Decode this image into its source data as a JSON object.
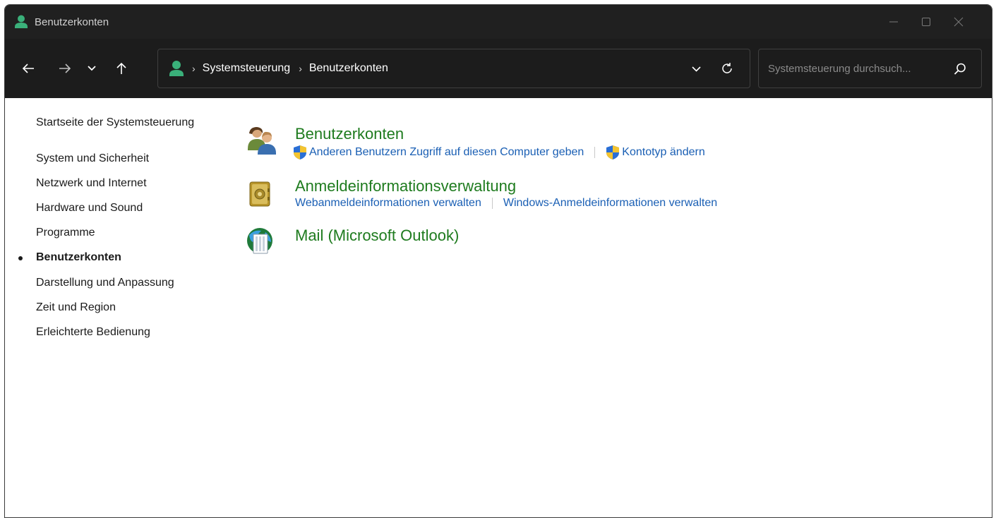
{
  "window": {
    "title": "Benutzerkonten"
  },
  "navbar": {
    "breadcrumb": [
      "Systemsteuerung",
      "Benutzerkonten"
    ],
    "search_placeholder": "Systemsteuerung durchsuch..."
  },
  "sidebar": {
    "home": "Startseite der Systemsteuerung",
    "items": [
      {
        "label": "System und Sicherheit"
      },
      {
        "label": "Netzwerk und Internet"
      },
      {
        "label": "Hardware und Sound"
      },
      {
        "label": "Programme"
      },
      {
        "label": "Benutzerkonten",
        "active": true
      },
      {
        "label": "Darstellung und Anpassung"
      },
      {
        "label": "Zeit und Region"
      },
      {
        "label": "Erleichterte Bedienung"
      }
    ]
  },
  "categories": [
    {
      "title": "Benutzerkonten",
      "icon": "users-icon",
      "links": [
        {
          "label": "Anderen Benutzern Zugriff auf diesen Computer geben",
          "shield": true
        },
        {
          "label": "Kontotyp ändern",
          "shield": true
        }
      ]
    },
    {
      "title": "Anmeldeinformationsverwaltung",
      "icon": "vault-icon",
      "links": [
        {
          "label": "Webanmeldeinformationen verwalten",
          "shield": false
        },
        {
          "label": "Windows-Anmeldeinformationen verwalten",
          "shield": false
        }
      ]
    },
    {
      "title": "Mail (Microsoft Outlook)",
      "icon": "mail-icon",
      "links": []
    }
  ],
  "colors": {
    "titlebar": "#202020",
    "navbar": "#1c1c1c",
    "category_title": "#1e7b1e",
    "link": "#1a5fb4",
    "user_icon_accent": "#3ab07a"
  }
}
